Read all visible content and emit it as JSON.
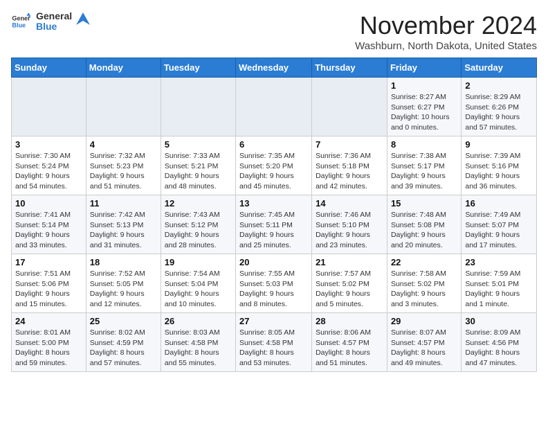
{
  "logo": {
    "line1": "General",
    "line2": "Blue"
  },
  "title": "November 2024",
  "subtitle": "Washburn, North Dakota, United States",
  "days_header": [
    "Sunday",
    "Monday",
    "Tuesday",
    "Wednesday",
    "Thursday",
    "Friday",
    "Saturday"
  ],
  "weeks": [
    [
      {
        "day": "",
        "sunrise": "",
        "sunset": "",
        "daylight": ""
      },
      {
        "day": "",
        "sunrise": "",
        "sunset": "",
        "daylight": ""
      },
      {
        "day": "",
        "sunrise": "",
        "sunset": "",
        "daylight": ""
      },
      {
        "day": "",
        "sunrise": "",
        "sunset": "",
        "daylight": ""
      },
      {
        "day": "",
        "sunrise": "",
        "sunset": "",
        "daylight": ""
      },
      {
        "day": "1",
        "sunrise": "Sunrise: 8:27 AM",
        "sunset": "Sunset: 6:27 PM",
        "daylight": "Daylight: 10 hours and 0 minutes."
      },
      {
        "day": "2",
        "sunrise": "Sunrise: 8:29 AM",
        "sunset": "Sunset: 6:26 PM",
        "daylight": "Daylight: 9 hours and 57 minutes."
      }
    ],
    [
      {
        "day": "3",
        "sunrise": "Sunrise: 7:30 AM",
        "sunset": "Sunset: 5:24 PM",
        "daylight": "Daylight: 9 hours and 54 minutes."
      },
      {
        "day": "4",
        "sunrise": "Sunrise: 7:32 AM",
        "sunset": "Sunset: 5:23 PM",
        "daylight": "Daylight: 9 hours and 51 minutes."
      },
      {
        "day": "5",
        "sunrise": "Sunrise: 7:33 AM",
        "sunset": "Sunset: 5:21 PM",
        "daylight": "Daylight: 9 hours and 48 minutes."
      },
      {
        "day": "6",
        "sunrise": "Sunrise: 7:35 AM",
        "sunset": "Sunset: 5:20 PM",
        "daylight": "Daylight: 9 hours and 45 minutes."
      },
      {
        "day": "7",
        "sunrise": "Sunrise: 7:36 AM",
        "sunset": "Sunset: 5:18 PM",
        "daylight": "Daylight: 9 hours and 42 minutes."
      },
      {
        "day": "8",
        "sunrise": "Sunrise: 7:38 AM",
        "sunset": "Sunset: 5:17 PM",
        "daylight": "Daylight: 9 hours and 39 minutes."
      },
      {
        "day": "9",
        "sunrise": "Sunrise: 7:39 AM",
        "sunset": "Sunset: 5:16 PM",
        "daylight": "Daylight: 9 hours and 36 minutes."
      }
    ],
    [
      {
        "day": "10",
        "sunrise": "Sunrise: 7:41 AM",
        "sunset": "Sunset: 5:14 PM",
        "daylight": "Daylight: 9 hours and 33 minutes."
      },
      {
        "day": "11",
        "sunrise": "Sunrise: 7:42 AM",
        "sunset": "Sunset: 5:13 PM",
        "daylight": "Daylight: 9 hours and 31 minutes."
      },
      {
        "day": "12",
        "sunrise": "Sunrise: 7:43 AM",
        "sunset": "Sunset: 5:12 PM",
        "daylight": "Daylight: 9 hours and 28 minutes."
      },
      {
        "day": "13",
        "sunrise": "Sunrise: 7:45 AM",
        "sunset": "Sunset: 5:11 PM",
        "daylight": "Daylight: 9 hours and 25 minutes."
      },
      {
        "day": "14",
        "sunrise": "Sunrise: 7:46 AM",
        "sunset": "Sunset: 5:10 PM",
        "daylight": "Daylight: 9 hours and 23 minutes."
      },
      {
        "day": "15",
        "sunrise": "Sunrise: 7:48 AM",
        "sunset": "Sunset: 5:08 PM",
        "daylight": "Daylight: 9 hours and 20 minutes."
      },
      {
        "day": "16",
        "sunrise": "Sunrise: 7:49 AM",
        "sunset": "Sunset: 5:07 PM",
        "daylight": "Daylight: 9 hours and 17 minutes."
      }
    ],
    [
      {
        "day": "17",
        "sunrise": "Sunrise: 7:51 AM",
        "sunset": "Sunset: 5:06 PM",
        "daylight": "Daylight: 9 hours and 15 minutes."
      },
      {
        "day": "18",
        "sunrise": "Sunrise: 7:52 AM",
        "sunset": "Sunset: 5:05 PM",
        "daylight": "Daylight: 9 hours and 12 minutes."
      },
      {
        "day": "19",
        "sunrise": "Sunrise: 7:54 AM",
        "sunset": "Sunset: 5:04 PM",
        "daylight": "Daylight: 9 hours and 10 minutes."
      },
      {
        "day": "20",
        "sunrise": "Sunrise: 7:55 AM",
        "sunset": "Sunset: 5:03 PM",
        "daylight": "Daylight: 9 hours and 8 minutes."
      },
      {
        "day": "21",
        "sunrise": "Sunrise: 7:57 AM",
        "sunset": "Sunset: 5:02 PM",
        "daylight": "Daylight: 9 hours and 5 minutes."
      },
      {
        "day": "22",
        "sunrise": "Sunrise: 7:58 AM",
        "sunset": "Sunset: 5:02 PM",
        "daylight": "Daylight: 9 hours and 3 minutes."
      },
      {
        "day": "23",
        "sunrise": "Sunrise: 7:59 AM",
        "sunset": "Sunset: 5:01 PM",
        "daylight": "Daylight: 9 hours and 1 minute."
      }
    ],
    [
      {
        "day": "24",
        "sunrise": "Sunrise: 8:01 AM",
        "sunset": "Sunset: 5:00 PM",
        "daylight": "Daylight: 8 hours and 59 minutes."
      },
      {
        "day": "25",
        "sunrise": "Sunrise: 8:02 AM",
        "sunset": "Sunset: 4:59 PM",
        "daylight": "Daylight: 8 hours and 57 minutes."
      },
      {
        "day": "26",
        "sunrise": "Sunrise: 8:03 AM",
        "sunset": "Sunset: 4:58 PM",
        "daylight": "Daylight: 8 hours and 55 minutes."
      },
      {
        "day": "27",
        "sunrise": "Sunrise: 8:05 AM",
        "sunset": "Sunset: 4:58 PM",
        "daylight": "Daylight: 8 hours and 53 minutes."
      },
      {
        "day": "28",
        "sunrise": "Sunrise: 8:06 AM",
        "sunset": "Sunset: 4:57 PM",
        "daylight": "Daylight: 8 hours and 51 minutes."
      },
      {
        "day": "29",
        "sunrise": "Sunrise: 8:07 AM",
        "sunset": "Sunset: 4:57 PM",
        "daylight": "Daylight: 8 hours and 49 minutes."
      },
      {
        "day": "30",
        "sunrise": "Sunrise: 8:09 AM",
        "sunset": "Sunset: 4:56 PM",
        "daylight": "Daylight: 8 hours and 47 minutes."
      }
    ]
  ]
}
